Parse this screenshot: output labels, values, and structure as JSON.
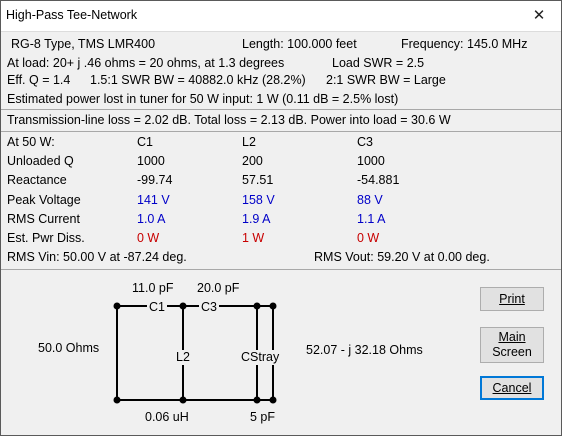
{
  "window": {
    "title": "High-Pass Tee-Network",
    "close_glyph": "✕"
  },
  "summary": {
    "cable": "RG-8 Type, TMS LMR400",
    "length": "Length:  100.000 feet",
    "frequency": "Frequency:  145.0 MHz",
    "at_load": "At load:  20+ j  .46 ohms =  20 ohms, at  1.3 degrees",
    "load_swr": "Load SWR =  2.5",
    "eff_q": "Eff. Q = 1.4",
    "swr_bw_15": "1.5:1 SWR BW = 40882.0 kHz (28.2%)",
    "swr_bw_2": "2:1 SWR BW = Large",
    "power_lost": "Estimated power lost in tuner for 50 W input:   1 W (0.11 dB = 2.5% lost)",
    "loss_line": "Transmission-line loss = 2.02 dB.  Total loss = 2.13 dB.  Power into load = 30.6 W"
  },
  "table": {
    "header_label": "At 50 W:",
    "columns": [
      "C1",
      "L2",
      "C3"
    ],
    "rows": [
      {
        "label": "Unloaded Q",
        "values": [
          "1000",
          "200",
          "1000"
        ],
        "color": "#000000"
      },
      {
        "label": "Reactance",
        "values": [
          "-99.74",
          "57.51",
          "-54.881"
        ],
        "color": "#000000"
      },
      {
        "label": "Peak Voltage",
        "values": [
          "141 V",
          "158 V",
          "88 V"
        ],
        "color": "#0000c8"
      },
      {
        "label": "RMS Current",
        "values": [
          "1.0 A",
          "1.9 A",
          "1.1 A"
        ],
        "color": "#0000c8"
      },
      {
        "label": "Est. Pwr Diss.",
        "values": [
          "0 W",
          "1 W",
          "0 W"
        ],
        "color": "#c80000"
      }
    ],
    "rms_vin": "RMS Vin:  50.00 V at -87.24 deg.",
    "rms_vout": "RMS Vout:  59.20 V at 0.00 deg."
  },
  "schematic": {
    "c1_value": "11.0 pF",
    "c3_value": "20.0 pF",
    "c1_label": "C1",
    "c3_label": "C3",
    "l2_label": "L2",
    "cstray_label": "CStray",
    "input_impedance": "50.0 Ohms",
    "output_impedance": "52.07 - j 32.18 Ohms",
    "l2_value": "0.06 uH",
    "cstray_value": "5 pF"
  },
  "buttons": {
    "print": "Print",
    "main_screen_1": "Main",
    "main_screen_2": "Screen",
    "cancel": "Cancel"
  }
}
